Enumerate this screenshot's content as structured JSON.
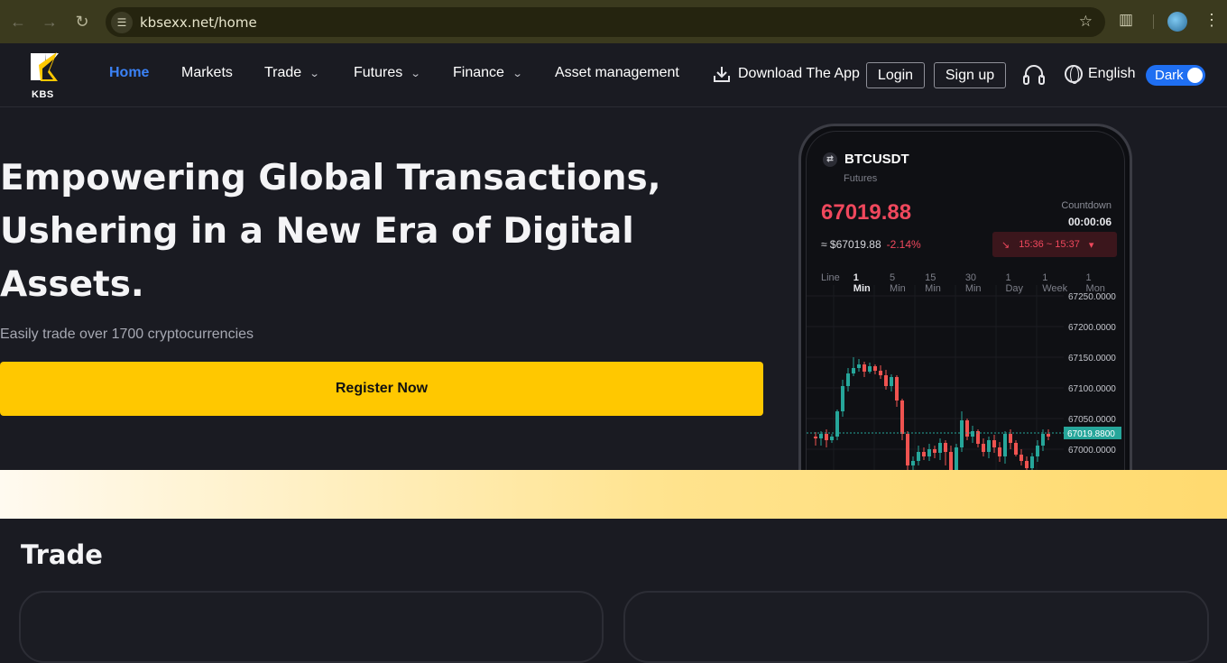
{
  "browser": {
    "url": "kbsexx.net/home",
    "back_icon": "arrow-left-icon",
    "forward_icon": "arrow-right-icon",
    "reload_icon": "reload-icon",
    "bookmark_icon": "star-icon",
    "extensions_icon": "puzzle-icon",
    "menu_icon": "kebab-icon"
  },
  "header": {
    "logo_text": "KBS",
    "nav": [
      {
        "label": "Home",
        "active": true
      },
      {
        "label": "Markets"
      },
      {
        "label": "Trade",
        "dropdown": true
      },
      {
        "label": "Futures",
        "dropdown": true
      },
      {
        "label": "Finance",
        "dropdown": true
      },
      {
        "label": "Asset management"
      }
    ],
    "download_label": "Download The App",
    "login_label": "Login",
    "signup_label": "Sign up",
    "language_label": "English",
    "theme_label": "Dark",
    "accent_color": "#1f6ff2"
  },
  "hero": {
    "title_line1": "Empowering Global Transactions,",
    "title_line2": "Ushering in a New Era of Digital",
    "title_line3": "Assets.",
    "subtitle": "Easily trade over 1700 cryptocurrencies",
    "cta_label": "Register Now",
    "cta_color": "#ffc800"
  },
  "phone": {
    "pair": "BTCUSDT",
    "market_type": "Futures",
    "price": "67019.88",
    "usd_price": "≈ $67019.88",
    "change": "-2.14%",
    "countdown_label": "Countdown",
    "countdown": "00:00:06",
    "time_range": "15:36 ~ 15:37",
    "intervals": [
      "Line",
      "1 Min",
      "5 Min",
      "15 Min",
      "30 Min",
      "1 Day",
      "1 Week",
      "1 Mon"
    ],
    "active_interval": "1 Min",
    "y_ticks": [
      "67250.0000",
      "67200.0000",
      "67150.0000",
      "67100.0000",
      "67050.0000",
      "67000.0000"
    ],
    "current_price_tag": "67019.8800",
    "up_color": "#26a69a",
    "down_color": "#ef5350"
  },
  "trade": {
    "heading": "Trade"
  }
}
